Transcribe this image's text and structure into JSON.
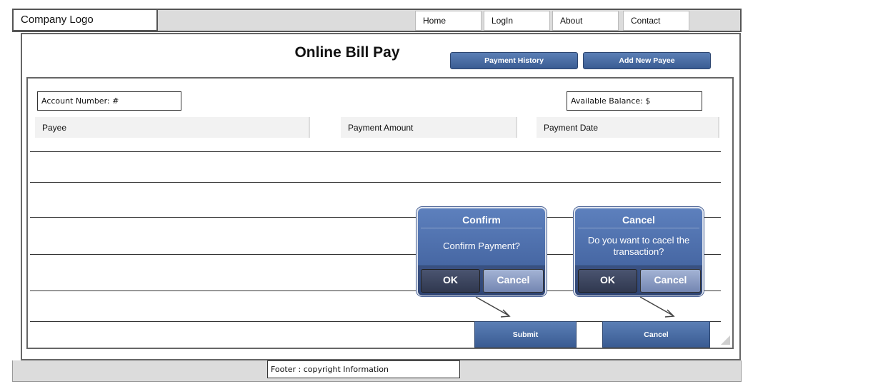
{
  "header": {
    "logo": "Company Logo",
    "nav": [
      {
        "label": "Home"
      },
      {
        "label": "LogIn"
      },
      {
        "label": "About"
      },
      {
        "label": "Contact"
      }
    ]
  },
  "main": {
    "title": "Online Bill Pay",
    "payment_history_label": "Payment History",
    "add_payee_label": "Add New Payee",
    "account_number": "Account Number: #",
    "available_balance": "Available Balance: $",
    "columns": [
      "Payee",
      "Payment Amount",
      "Payment Date"
    ]
  },
  "dialogs": {
    "confirm": {
      "title": "Confirm",
      "message": "Confirm Payment?",
      "ok": "OK",
      "cancel": "Cancel"
    },
    "cancel": {
      "title": "Cancel",
      "message": "Do you want to cacel the transaction?",
      "ok": "OK",
      "cancel": "Cancel"
    }
  },
  "actions": {
    "submit": "Submit",
    "cancel": "Cancel"
  },
  "footer": {
    "text": "Footer : copyright Information"
  },
  "colors": {
    "button_blue": "#4a6ea8",
    "header_gray": "#dcdcdc"
  }
}
